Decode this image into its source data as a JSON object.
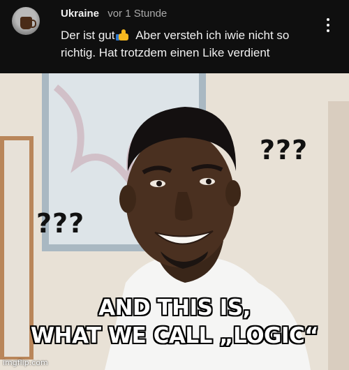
{
  "comment": {
    "author": "Ukraine",
    "timestamp": "vor 1 Stunde",
    "text_part1": "Der ist gut.",
    "text_part2": "Aber versteh ich iwie nicht so richtig. Hat trotzdem einen Like verdient",
    "emoji_icon": "thumbs-up-icon",
    "menu_icon": "more-vertical-icon"
  },
  "meme": {
    "question_marks_right": "???",
    "question_marks_left": "???",
    "caption_line1": "AND THIS IS,",
    "caption_line2": "WHAT WE CALL „LOGIC“",
    "watermark": "imgflip.com"
  },
  "colors": {
    "background": "#0f0f0f",
    "text_primary": "#f1f1f1",
    "text_secondary": "#aaaaaa",
    "caption_fill": "#ffffff",
    "caption_outline": "#000000"
  }
}
